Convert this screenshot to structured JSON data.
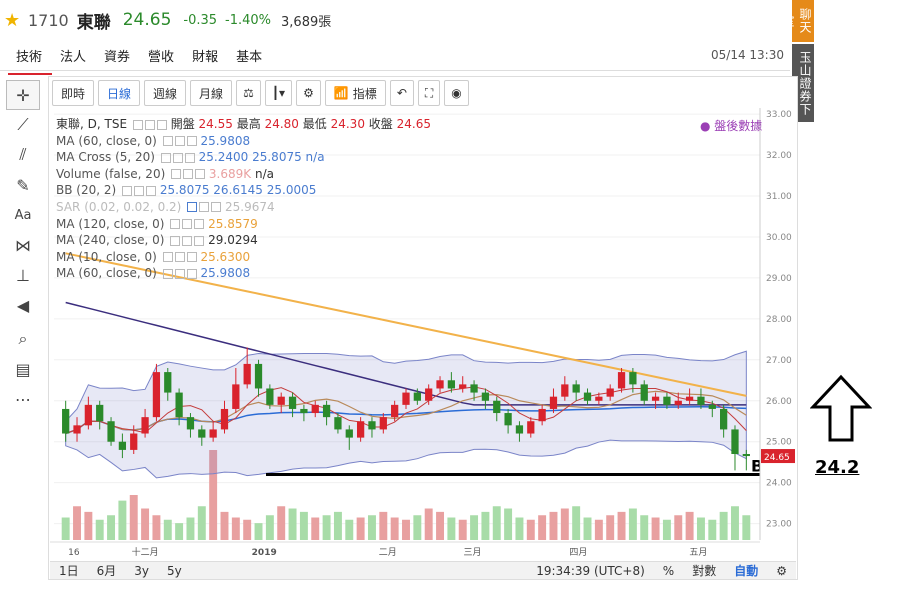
{
  "header": {
    "code": "1710",
    "name": "東聯",
    "price": "24.65",
    "change": "-0.35",
    "change_pct": "-1.40%",
    "volume": "3,689張",
    "datetime": "05/14 13:30"
  },
  "nav_tabs": [
    "技術",
    "法人",
    "資券",
    "營收",
    "財報",
    "基本"
  ],
  "side_tabs": [
    "聊天室",
    "玉山證券下單"
  ],
  "toolbar": {
    "b1": "即時",
    "b2": "日線",
    "b3": "週線",
    "b4": "月線",
    "b5": "指標"
  },
  "legend": {
    "l1": "東聯, D, TSE",
    "l1_open_lbl": "開盤",
    "l1_open": "24.55",
    "l1_high_lbl": "最高",
    "l1_high": "24.80",
    "l1_low_lbl": "最低",
    "l1_low": "24.30",
    "l1_close_lbl": "收盤",
    "l1_close": "24.65",
    "l2": "MA (60, close, 0)",
    "l2v": "25.9808",
    "l3": "MA Cross (5, 20)",
    "l3v": "25.2400",
    "l3v2": "25.8075",
    "l3v3": "n/a",
    "l4": "Volume (false, 20)",
    "l4v": "3.689K",
    "l4v2": "n/a",
    "l5": "BB (20, 2)",
    "l5v": "25.8075",
    "l5v2": "26.6145",
    "l5v3": "25.0005",
    "l6": "SAR (0.02, 0.02, 0.2)",
    "l6v": "25.9674",
    "l7": "MA (120, close, 0)",
    "l7v": "25.8579",
    "l8": "MA (240, close, 0)",
    "l8v": "29.0294",
    "l9": "MA (10, close, 0)",
    "l9v": "25.6300",
    "l10": "MA (60, close, 0)",
    "l10v": "25.9808"
  },
  "after_hours": "● 盤後數據",
  "bottom": {
    "r1": "1日",
    "r2": "6月",
    "r3": "3y",
    "r4": "5y",
    "time": "19:34:39 (UTC+8)",
    "pct": "%",
    "log": "對數",
    "auto": "自動"
  },
  "annotation": {
    "arrow_label": "24.2",
    "marker": "B"
  },
  "chart_data": {
    "type": "bar",
    "title": "東聯, D, TSE",
    "y_ticks": [
      "33.00",
      "32.00",
      "31.00",
      "30.00",
      "29.00",
      "28.00",
      "27.00",
      "26.00",
      "25.00",
      "24.00",
      "23.00"
    ],
    "x_ticks": [
      "16",
      "十二月",
      "2019",
      "二月",
      "三月",
      "四月",
      "五月"
    ],
    "last_price_label": "24.65",
    "ylim": [
      22.6,
      33.1
    ],
    "support_line": 24.2,
    "candles": [
      [
        25.8,
        25.2,
        26.0,
        25.0
      ],
      [
        25.2,
        25.4,
        25.6,
        25.0
      ],
      [
        25.4,
        25.9,
        26.1,
        25.3
      ],
      [
        25.9,
        25.5,
        26.0,
        25.3
      ],
      [
        25.5,
        25.0,
        25.6,
        24.9
      ],
      [
        25.0,
        24.8,
        25.2,
        24.6
      ],
      [
        24.8,
        25.2,
        25.4,
        24.7
      ],
      [
        25.2,
        25.6,
        25.8,
        25.1
      ],
      [
        25.6,
        26.7,
        26.9,
        25.5
      ],
      [
        26.7,
        26.2,
        26.8,
        26.0
      ],
      [
        26.2,
        25.6,
        26.3,
        25.4
      ],
      [
        25.6,
        25.3,
        25.7,
        25.1
      ],
      [
        25.3,
        25.1,
        25.4,
        24.9
      ],
      [
        25.1,
        25.3,
        25.5,
        25.0
      ],
      [
        25.3,
        25.8,
        26.0,
        25.2
      ],
      [
        25.8,
        26.4,
        26.8,
        25.7
      ],
      [
        26.4,
        26.9,
        27.3,
        26.3
      ],
      [
        26.9,
        26.3,
        27.0,
        26.1
      ],
      [
        26.3,
        25.9,
        26.4,
        25.8
      ],
      [
        25.9,
        26.1,
        26.2,
        25.7
      ],
      [
        26.1,
        25.8,
        26.2,
        25.6
      ],
      [
        25.8,
        25.7,
        25.9,
        25.5
      ],
      [
        25.7,
        25.9,
        26.0,
        25.6
      ],
      [
        25.9,
        25.6,
        26.0,
        25.4
      ],
      [
        25.6,
        25.3,
        25.7,
        25.2
      ],
      [
        25.3,
        25.1,
        25.4,
        24.8
      ],
      [
        25.1,
        25.5,
        25.6,
        25.0
      ],
      [
        25.5,
        25.3,
        25.6,
        25.1
      ],
      [
        25.3,
        25.6,
        25.7,
        25.2
      ],
      [
        25.6,
        25.9,
        26.0,
        25.5
      ],
      [
        25.9,
        26.2,
        26.3,
        25.8
      ],
      [
        26.2,
        26.0,
        26.3,
        25.9
      ],
      [
        26.0,
        26.3,
        26.4,
        25.9
      ],
      [
        26.3,
        26.5,
        26.6,
        26.2
      ],
      [
        26.5,
        26.3,
        26.7,
        26.2
      ],
      [
        26.3,
        26.4,
        26.6,
        26.2
      ],
      [
        26.4,
        26.2,
        26.5,
        26.0
      ],
      [
        26.2,
        26.0,
        26.3,
        25.8
      ],
      [
        26.0,
        25.7,
        26.1,
        25.5
      ],
      [
        25.7,
        25.4,
        25.8,
        25.2
      ],
      [
        25.4,
        25.2,
        25.5,
        25.0
      ],
      [
        25.2,
        25.5,
        25.6,
        25.1
      ],
      [
        25.5,
        25.8,
        25.9,
        25.4
      ],
      [
        25.8,
        26.1,
        26.3,
        25.7
      ],
      [
        26.1,
        26.4,
        26.6,
        26.0
      ],
      [
        26.4,
        26.2,
        26.5,
        26.0
      ],
      [
        26.2,
        26.0,
        26.3,
        25.9
      ],
      [
        26.0,
        26.1,
        26.2,
        25.9
      ],
      [
        26.1,
        26.3,
        26.4,
        26.0
      ],
      [
        26.3,
        26.7,
        26.8,
        26.2
      ],
      [
        26.7,
        26.4,
        26.8,
        26.2
      ],
      [
        26.4,
        26.0,
        26.5,
        25.9
      ],
      [
        26.0,
        26.1,
        26.2,
        25.8
      ],
      [
        26.1,
        25.9,
        26.2,
        25.8
      ],
      [
        25.9,
        26.0,
        26.2,
        25.8
      ],
      [
        26.0,
        26.1,
        26.3,
        25.9
      ],
      [
        26.1,
        25.9,
        26.3,
        25.8
      ],
      [
        25.9,
        25.8,
        26.0,
        25.6
      ],
      [
        25.8,
        25.3,
        25.9,
        25.1
      ],
      [
        25.3,
        24.7,
        25.4,
        24.3
      ],
      [
        24.7,
        24.65,
        24.8,
        24.3
      ]
    ],
    "volumes": [
      20,
      30,
      25,
      18,
      22,
      35,
      40,
      28,
      22,
      18,
      15,
      20,
      30,
      80,
      25,
      20,
      18,
      15,
      22,
      30,
      28,
      25,
      20,
      22,
      25,
      18,
      20,
      22,
      25,
      20,
      18,
      22,
      28,
      25,
      20,
      18,
      22,
      25,
      30,
      28,
      20,
      18,
      22,
      25,
      28,
      30,
      20,
      18,
      22,
      25,
      28,
      22,
      20,
      18,
      22,
      25,
      20,
      18,
      25,
      30,
      22
    ]
  }
}
